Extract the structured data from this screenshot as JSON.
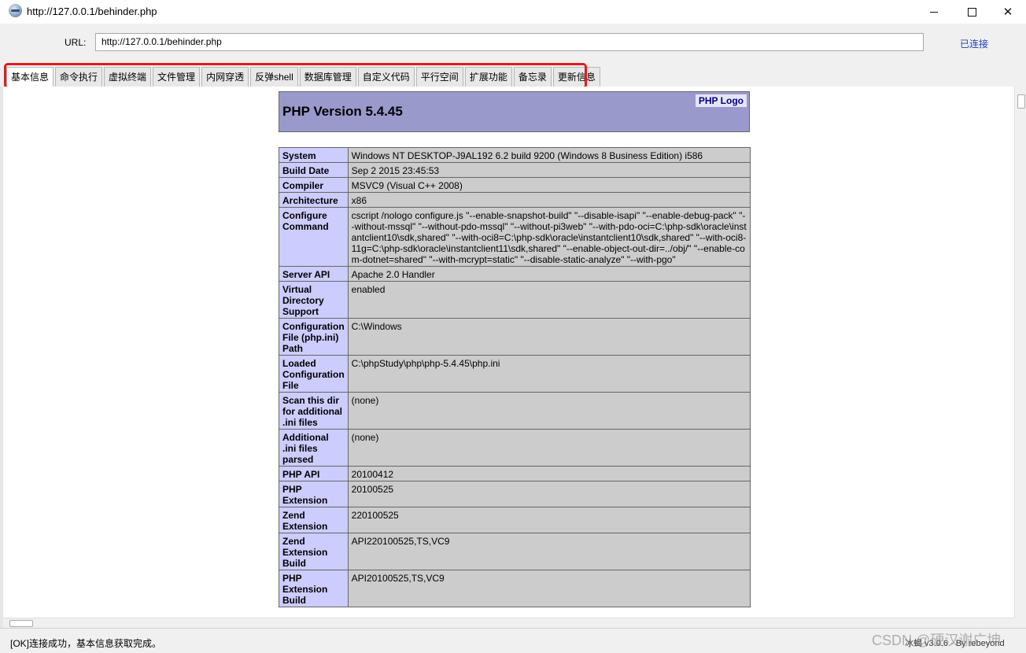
{
  "window": {
    "title": "http://127.0.0.1/behinder.php",
    "minimize_glyph": "",
    "close_glyph": "✕"
  },
  "urlbar": {
    "label": "URL:",
    "value": "http://127.0.0.1/behinder.php",
    "status": "已连接"
  },
  "tabs": [
    {
      "label": "基本信息",
      "active": true
    },
    {
      "label": "命令执行"
    },
    {
      "label": "虚拟终端"
    },
    {
      "label": "文件管理"
    },
    {
      "label": "内网穿透"
    },
    {
      "label": "反弹shell"
    },
    {
      "label": "数据库管理"
    },
    {
      "label": "自定义代码"
    },
    {
      "label": "平行空间"
    },
    {
      "label": "扩展功能"
    },
    {
      "label": "备忘录"
    },
    {
      "label": "更新信息"
    }
  ],
  "phpinfo": {
    "version": "PHP Version 5.4.45",
    "logo_text": "PHP Logo",
    "rows": [
      {
        "key": "System",
        "value": "Windows NT DESKTOP-J9AL192 6.2 build 9200 (Windows 8 Business Edition) i586"
      },
      {
        "key": "Build Date",
        "value": "Sep 2 2015 23:45:53"
      },
      {
        "key": "Compiler",
        "value": "MSVC9 (Visual C++ 2008)"
      },
      {
        "key": "Architecture",
        "value": "x86"
      },
      {
        "key": "Configure Command",
        "value": "cscript /nologo configure.js \"--enable-snapshot-build\" \"--disable-isapi\" \"--enable-debug-pack\" \"--without-mssql\" \"--without-pdo-mssql\" \"--without-pi3web\" \"--with-pdo-oci=C:\\php-sdk\\oracle\\instantclient10\\sdk,shared\" \"--with-oci8=C:\\php-sdk\\oracle\\instantclient10\\sdk,shared\" \"--with-oci8-11g=C:\\php-sdk\\oracle\\instantclient11\\sdk,shared\" \"--enable-object-out-dir=../obj/\" \"--enable-com-dotnet=shared\" \"--with-mcrypt=static\" \"--disable-static-analyze\" \"--with-pgo\""
      },
      {
        "key": "Server API",
        "value": "Apache 2.0 Handler"
      },
      {
        "key": "Virtual Directory Support",
        "value": "enabled"
      },
      {
        "key": "Configuration File (php.ini) Path",
        "value": "C:\\Windows"
      },
      {
        "key": "Loaded Configuration File",
        "value": "C:\\phpStudy\\php\\php-5.4.45\\php.ini"
      },
      {
        "key": "Scan this dir for additional .ini files",
        "value": "(none)"
      },
      {
        "key": "Additional .ini files parsed",
        "value": "(none)"
      },
      {
        "key": "PHP API",
        "value": "20100412"
      },
      {
        "key": "PHP Extension",
        "value": "20100525"
      },
      {
        "key": "Zend Extension",
        "value": "220100525"
      },
      {
        "key": "Zend Extension Build",
        "value": "API220100525,TS,VC9"
      },
      {
        "key": "PHP Extension Build",
        "value": "API20100525,TS,VC9"
      }
    ]
  },
  "statusbar": {
    "message": "[OK]连接成功，基本信息获取完成。",
    "version": "冰蝎 v3.0.6 · By rebeyond",
    "watermark": "CSDN @硬汉谢广坤"
  }
}
